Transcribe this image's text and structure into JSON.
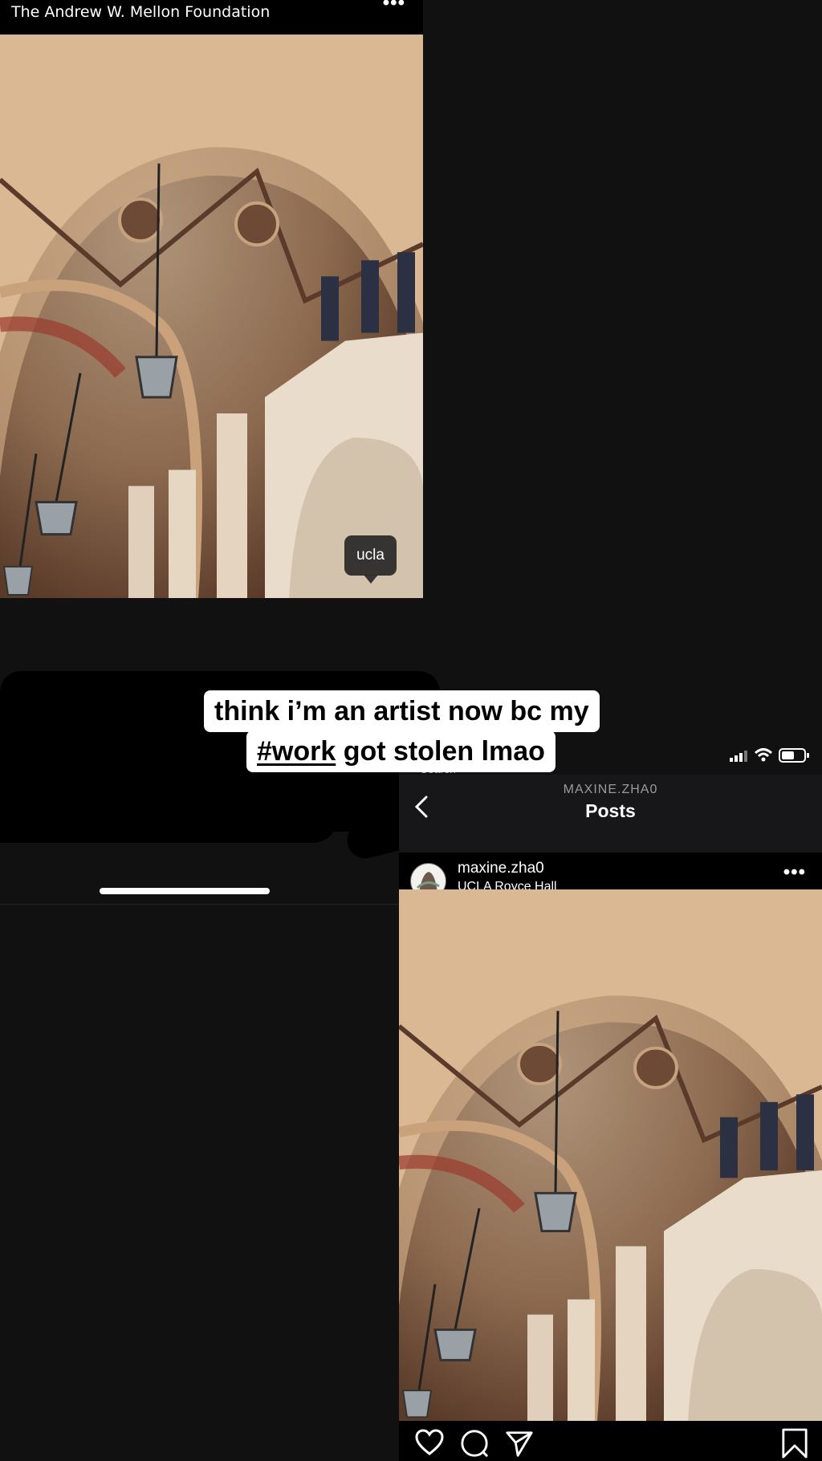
{
  "left_post": {
    "account_name": "The Andrew W. Mellon Foundation",
    "more_icon": "more-dots-icon",
    "location_tag": "ucla",
    "actions": {
      "comment_icon": "comment-icon",
      "share_icon": "share-icon",
      "save_icon": "bookmark-icon"
    }
  },
  "story_caption": {
    "line1": "think i’m an artist now bc my",
    "hashtag": "#work",
    "line2_rest": " got stolen lmao"
  },
  "right_post": {
    "status_bar": {
      "signal_icon": "cell-signal-icon",
      "wifi_icon": "wifi-icon",
      "battery_icon": "battery-icon"
    },
    "back_label": "‹ Search",
    "nav_username": "MAXINE.ZHA0",
    "nav_title": "Posts",
    "username": "maxine.zha0",
    "location": "UCLA Royce Hall",
    "actions": {
      "like_icon": "heart-icon",
      "comment_icon": "comment-icon",
      "share_icon": "share-icon",
      "save_icon": "bookmark-icon"
    }
  },
  "colors": {
    "background": "#111112",
    "caption_bg": "#ffffff",
    "caption_text": "#000000",
    "nav_bar": "#17171a"
  }
}
